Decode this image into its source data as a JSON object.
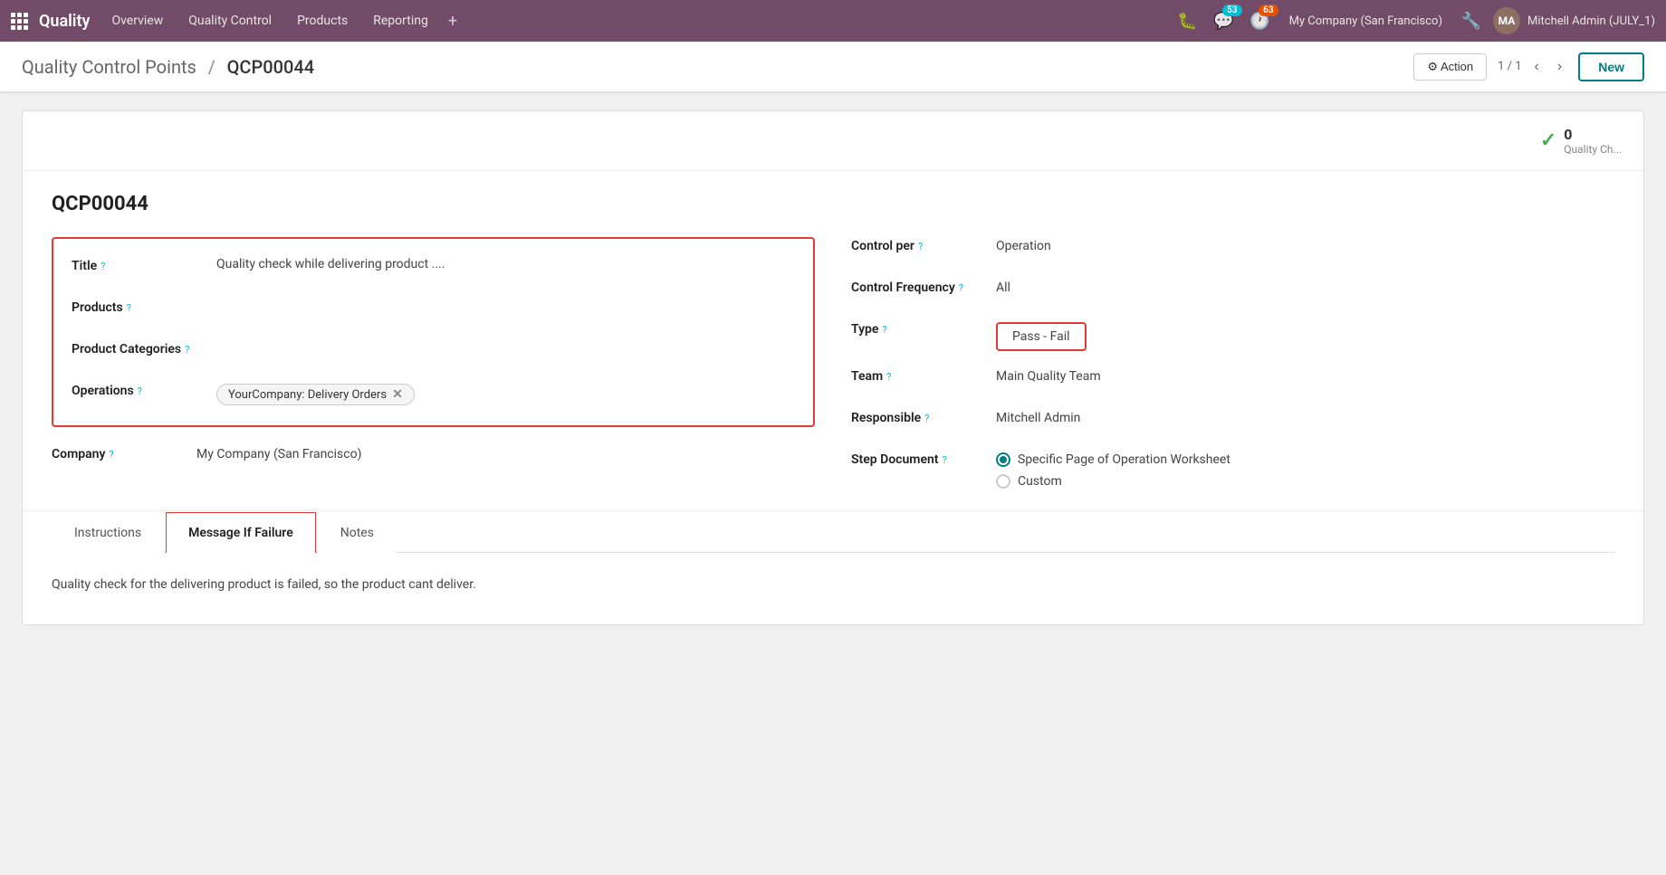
{
  "app": {
    "name": "Quality",
    "nav_items": [
      "Overview",
      "Quality Control",
      "Products",
      "Reporting"
    ]
  },
  "topbar": {
    "company": "My Company (San Francisco)",
    "user": "Mitchell Admin (JULY_1)",
    "chat_badge": "53",
    "activity_badge": "63"
  },
  "page": {
    "breadcrumb_parent": "Quality Control Points",
    "breadcrumb_separator": "/",
    "breadcrumb_current": "QCP00044",
    "action_label": "⚙ Action",
    "pager_text": "1 / 1",
    "new_label": "New"
  },
  "qc_stats": {
    "count": "0",
    "label": "Quality Ch..."
  },
  "form": {
    "record_id": "QCP00044",
    "title_label": "Title",
    "title_help": "?",
    "title_value": "Quality check while delivering product ....",
    "products_label": "Products",
    "products_help": "?",
    "product_categories_label": "Product Categories",
    "product_categories_help": "?",
    "operations_label": "Operations",
    "operations_help": "?",
    "operations_tag": "YourCompany: Delivery Orders",
    "company_label": "Company",
    "company_help": "?",
    "company_value": "My Company (San Francisco)",
    "control_per_label": "Control per",
    "control_per_help": "?",
    "control_per_value": "Operation",
    "control_frequency_label": "Control Frequency",
    "control_frequency_help": "?",
    "control_frequency_value": "All",
    "type_label": "Type",
    "type_help": "?",
    "type_value": "Pass - Fail",
    "team_label": "Team",
    "team_help": "?",
    "team_value": "Main Quality Team",
    "responsible_label": "Responsible",
    "responsible_help": "?",
    "responsible_value": "Mitchell Admin",
    "step_document_label": "Step Document",
    "step_document_help": "?",
    "step_document_option1": "Specific Page of Operation Worksheet",
    "step_document_option2": "Custom"
  },
  "tabs": {
    "items": [
      {
        "id": "instructions",
        "label": "Instructions"
      },
      {
        "id": "message-if-failure",
        "label": "Message If Failure"
      },
      {
        "id": "notes",
        "label": "Notes"
      }
    ],
    "active": "message-if-failure",
    "content": "Quality check for the  delivering product is failed, so the product cant deliver."
  }
}
